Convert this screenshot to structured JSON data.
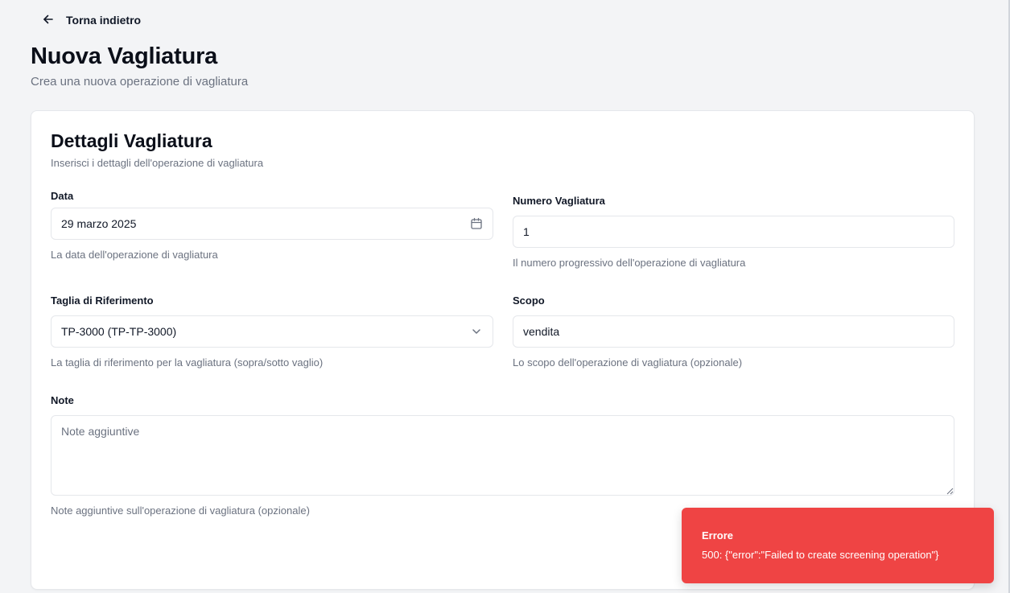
{
  "header": {
    "back_label": "Torna indietro",
    "title": "Nuova Vagliatura",
    "subtitle": "Crea una nuova operazione di vagliatura"
  },
  "card": {
    "title": "Dettagli Vagliatura",
    "description": "Inserisci i dettagli dell'operazione di vagliatura"
  },
  "form": {
    "data": {
      "label": "Data",
      "value": "29 marzo 2025",
      "help": "La data dell'operazione di vagliatura",
      "icon": "calendar-icon"
    },
    "numero": {
      "label": "Numero Vagliatura",
      "value": "1",
      "help": "Il numero progressivo dell'operazione di vagliatura"
    },
    "taglia": {
      "label": "Taglia di Riferimento",
      "value": "TP-3000 (TP-TP-3000)",
      "help": "La taglia di riferimento per la vagliatura (sopra/sotto vaglio)",
      "icon": "chevron-down-icon"
    },
    "scopo": {
      "label": "Scopo",
      "value": "vendita",
      "help": "Lo scopo dell'operazione di vagliatura (opzionale)"
    },
    "note": {
      "label": "Note",
      "placeholder": "Note aggiuntive",
      "value": "",
      "help": "Note aggiuntive sull'operazione di vagliatura (opzionale)"
    }
  },
  "toast": {
    "title": "Errore",
    "message": "500: {\"error\":\"Failed to create screening operation\"}",
    "color": "#ef4444"
  }
}
